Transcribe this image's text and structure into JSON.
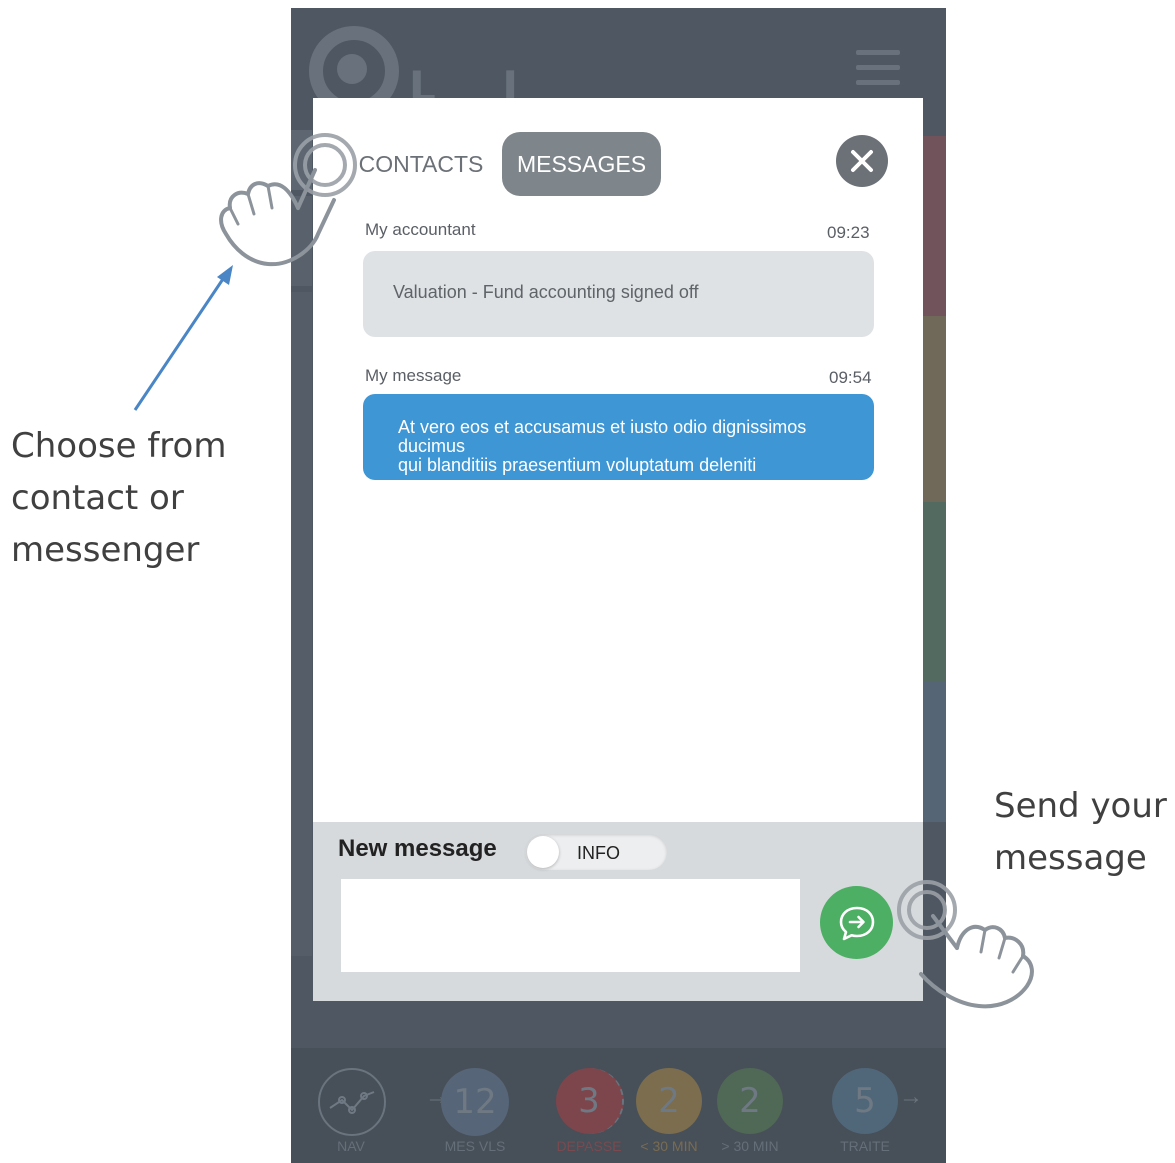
{
  "app": {
    "logo_text": "L I S"
  },
  "tabs": {
    "contacts": "CONTACTS",
    "messages": "MESSAGES"
  },
  "messages": [
    {
      "sender": "My accountant",
      "time": "09:23",
      "text": "Valuation - Fund accounting signed off"
    },
    {
      "sender": "My message",
      "time": "09:54",
      "text_line1": "At vero eos et accusamus et iusto odio dignissimos ducimus",
      "text_line2": "qui blanditiis praesentium voluptatum deleniti"
    }
  ],
  "compose": {
    "label": "New message",
    "toggle_label": "INFO",
    "input_value": ""
  },
  "bottom_nav": [
    {
      "value": "",
      "label": "NAV",
      "icon": "chart-line-icon"
    },
    {
      "value": "12",
      "label": "MES VLS"
    },
    {
      "value": "3",
      "label": "DEPASSE"
    },
    {
      "value": "2",
      "label": "< 30 MIN"
    },
    {
      "value": "2",
      "label": "> 30 MIN"
    },
    {
      "value": "5",
      "label": "TRAITE"
    }
  ],
  "annotations": {
    "left_line1": "Choose from",
    "left_line2": "contact or",
    "left_line3": "messenger",
    "right_line1": "Send your",
    "right_line2": "message"
  },
  "colors": {
    "tab_active": "#7e858b",
    "bubble_incoming": "#dfe2e5",
    "bubble_outgoing": "#3e96d4",
    "send_button": "#4caf63",
    "backdrop": "#4f5862"
  }
}
